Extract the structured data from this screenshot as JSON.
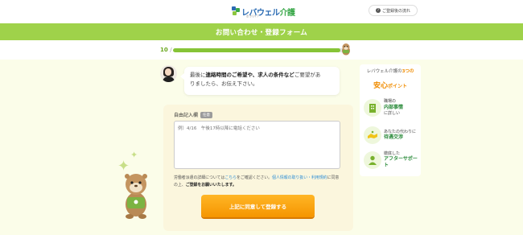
{
  "header": {
    "logo_text": "レバウェル",
    "logo_accent": "介護",
    "logo_sub": "旧 きらケア",
    "flow_button": "ご登録後の流れ",
    "flow_icon": "question-icon"
  },
  "banner": {
    "title": "お問い合わせ・登録フォーム"
  },
  "progress": {
    "step": "10",
    "separator": "/",
    "fraction": 0.98
  },
  "chat": {
    "line1_pre": "最後に",
    "line1_bold": "連絡時間のご希望や、求人の条件など",
    "line1_post": "ご要望があ",
    "line2": "りましたら、お伝え下さい。"
  },
  "form": {
    "label": "自由記入欄",
    "badge": "任意",
    "placeholder": "例）4/16　午後17時以降に電話ください",
    "terms_1": "労働者派遣の詳細については",
    "terms_link1": "こちら",
    "terms_2": "をご確認ください。",
    "terms_link2": "個人情報の取り扱い・利用規約",
    "terms_3": "に同意の上、",
    "terms_bold": "ご登録をお願いいたします。",
    "submit": "上記に同意して登録する"
  },
  "sidebar": {
    "title_pre": "レバウェル介護の",
    "title_num": "3つの",
    "big": "安心",
    "point": "ポイント",
    "items": [
      {
        "icon": "building-icon",
        "pre": "職場の",
        "bold": "内部事情",
        "post": "に詳しい"
      },
      {
        "icon": "handshake-icon",
        "pre": "あなたの代わりに",
        "bold": "待遇交渉",
        "post": ""
      },
      {
        "icon": "support-person-icon",
        "pre": "徹底した",
        "bold": "アフターサポート",
        "post": ""
      }
    ]
  },
  "colors": {
    "brand_green": "#9fd24a",
    "progress": "#86c437",
    "cta": "#f59500",
    "accent_orange": "#f08c00"
  }
}
